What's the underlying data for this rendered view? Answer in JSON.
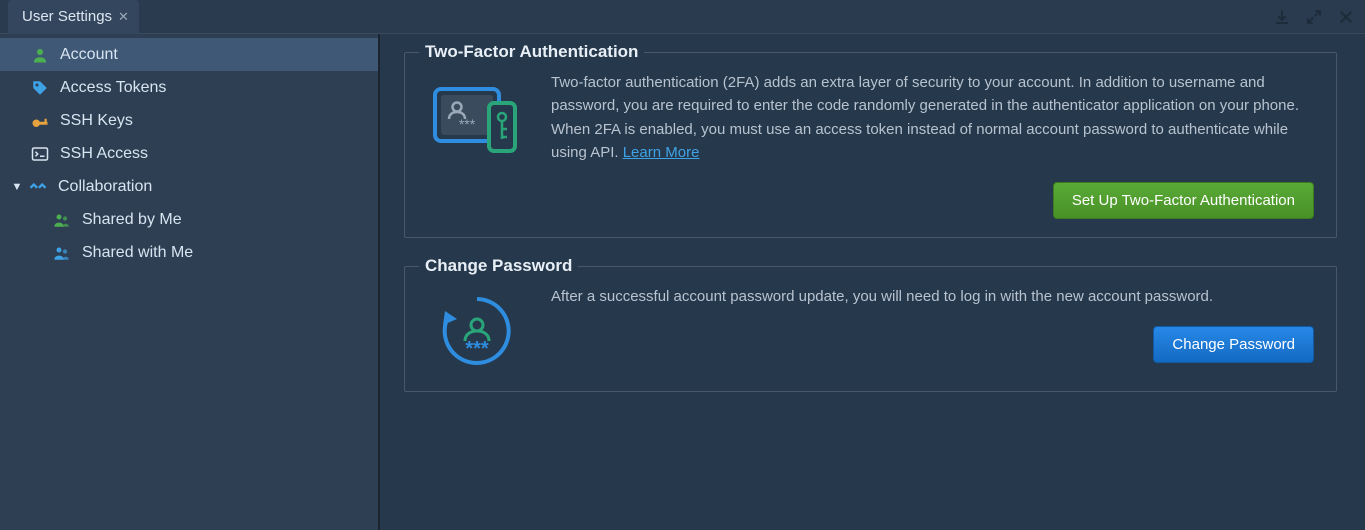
{
  "tab": {
    "title": "User Settings"
  },
  "sidebar": {
    "items": [
      {
        "label": "Account"
      },
      {
        "label": "Access Tokens"
      },
      {
        "label": "SSH Keys"
      },
      {
        "label": "SSH Access"
      },
      {
        "label": "Collaboration"
      },
      {
        "label": "Shared by Me"
      },
      {
        "label": "Shared with Me"
      }
    ]
  },
  "section_2fa": {
    "title": "Two-Factor Authentication",
    "desc": "Two-factor authentication (2FA) adds an extra layer of security to your account. In addition to username and password, you are required to enter the code randomly generated in the authenticator application on your phone. When 2FA is enabled, you must use an access token instead of normal account password to authenticate while using API. ",
    "learn_more": "Learn More",
    "button": "Set Up Two-Factor Authentication"
  },
  "section_pw": {
    "title": "Change Password",
    "desc": "After a successful account password update, you will need to log in with the new account password.",
    "button": "Change Password"
  }
}
